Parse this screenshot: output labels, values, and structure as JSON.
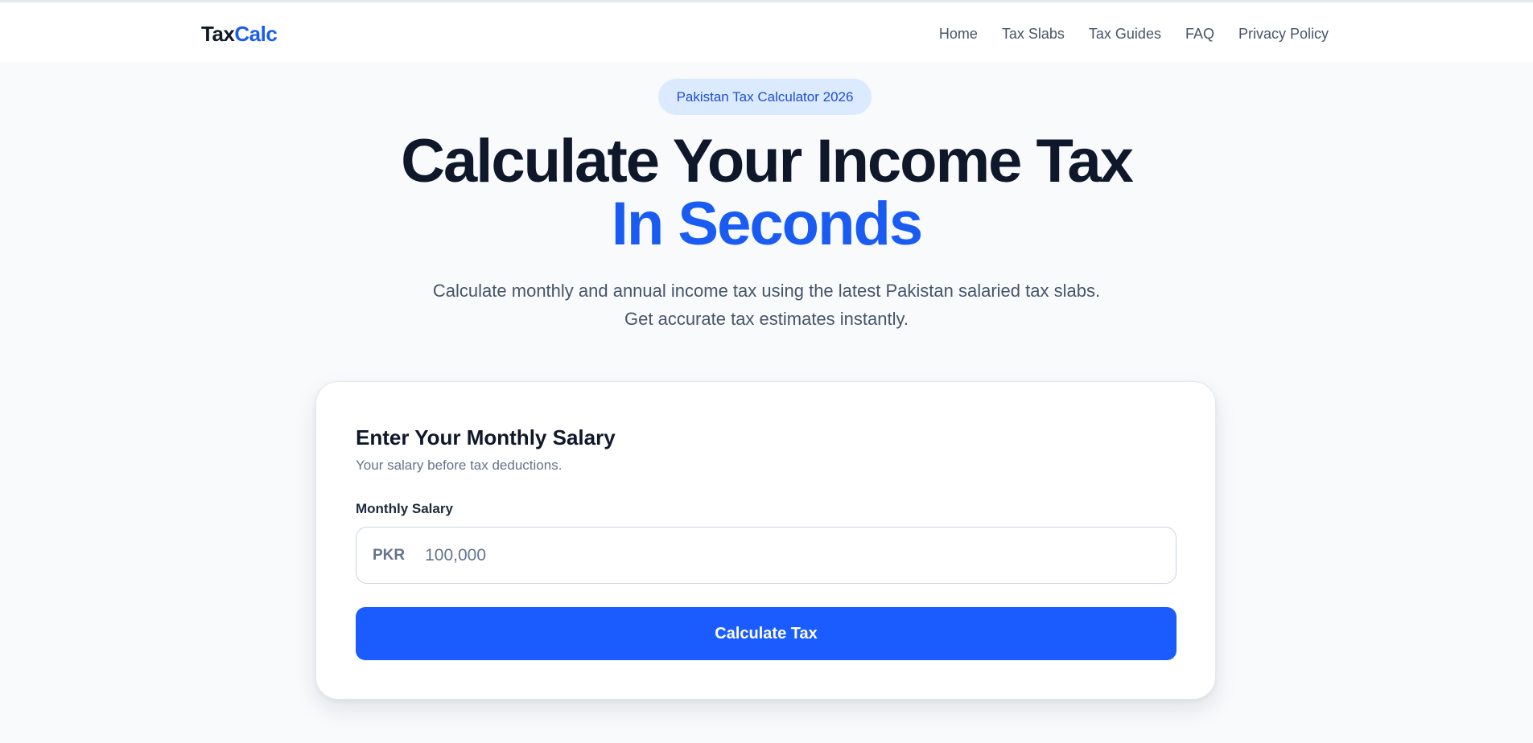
{
  "brand": {
    "part1": "Tax",
    "part2": "Calc",
    "accent_color": "#1a5cf2"
  },
  "nav": {
    "items": [
      {
        "label": "Home"
      },
      {
        "label": "Tax Slabs"
      },
      {
        "label": "Tax Guides"
      },
      {
        "label": "FAQ"
      },
      {
        "label": "Privacy Policy"
      }
    ]
  },
  "hero": {
    "badge": "Pakistan Tax Calculator 2026",
    "title_line1": "Calculate Your Income Tax",
    "title_line2": "In Seconds",
    "subtitle_line1": "Calculate monthly and annual income tax using the latest Pakistan salaried tax slabs.",
    "subtitle_line2": "Get accurate tax estimates instantly."
  },
  "calculator": {
    "title": "Enter Your Monthly Salary",
    "subtitle": "Your salary before tax deductions.",
    "field_label": "Monthly Salary",
    "currency_prefix": "PKR",
    "input_placeholder": "100,000",
    "input_value": "",
    "button_label": "Calculate Tax",
    "button_color": "#1a5cff"
  }
}
